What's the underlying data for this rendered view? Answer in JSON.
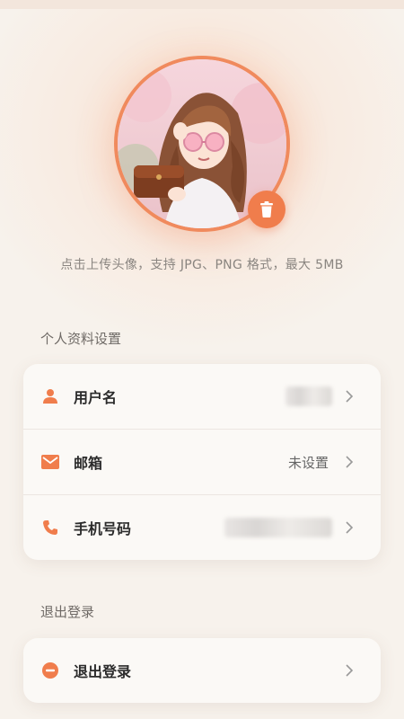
{
  "avatar": {
    "hint": "点击上传头像，支持 JPG、PNG 格式，最大 5MB"
  },
  "profile_section": {
    "title": "个人资料设置",
    "items": [
      {
        "label": "用户名",
        "value": "",
        "icon": "person-icon"
      },
      {
        "label": "邮箱",
        "value": "未设置",
        "icon": "mail-icon"
      },
      {
        "label": "手机号码",
        "value": "",
        "icon": "phone-icon"
      }
    ]
  },
  "logout_section": {
    "title": "退出登录",
    "items": [
      {
        "label": "退出登录",
        "icon": "minus-circle-icon"
      }
    ]
  },
  "colors": {
    "accent": "#f07d4c",
    "background": "#f7f2ec"
  }
}
